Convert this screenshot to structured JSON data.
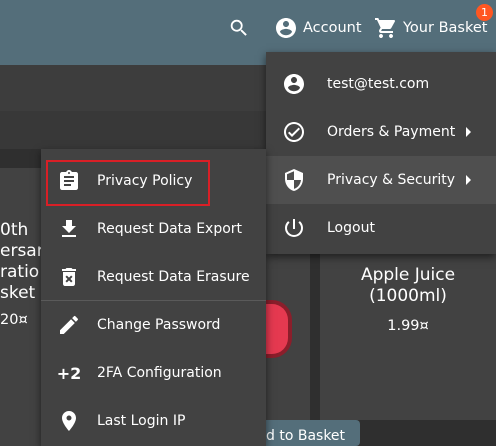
{
  "header": {
    "search_icon": "search-icon",
    "account_label": "Account",
    "basket_label": "Your Basket",
    "basket_count": "1"
  },
  "products": {
    "left_card_lines": [
      "0th",
      "ersar",
      "ratio",
      "sket"
    ],
    "left_card_price": "20¤",
    "center_card_button": "d to Basket",
    "right_card_name_line1": "Apple Juice",
    "right_card_name_line2": "(1000ml)",
    "right_card_price": "1.99¤"
  },
  "account_menu": {
    "items": [
      {
        "label": "test@test.com",
        "icon": "account-circle-icon"
      },
      {
        "label": "Orders & Payment",
        "icon": "check-circle-icon",
        "submenu": true
      },
      {
        "label": "Privacy & Security",
        "icon": "shield-icon",
        "submenu": true
      },
      {
        "label": "Logout",
        "icon": "power-icon"
      }
    ]
  },
  "privacy_menu": {
    "items": [
      {
        "label": "Privacy Policy",
        "icon": "clipboard-icon"
      },
      {
        "label": "Request Data Export",
        "icon": "download-icon"
      },
      {
        "label": "Request Data Erasure",
        "icon": "trash-icon"
      },
      {
        "label": "Change Password",
        "icon": "pencil-icon"
      },
      {
        "label": "2FA Configuration",
        "icon": "plus-two-icon",
        "icon_text": "+2"
      },
      {
        "label": "Last Login IP",
        "icon": "location-pin-icon"
      }
    ]
  },
  "colors": {
    "toolbar": "#546e7a",
    "menu_bg": "#424242",
    "highlight": "#d91f26",
    "badge": "#ff5722"
  }
}
